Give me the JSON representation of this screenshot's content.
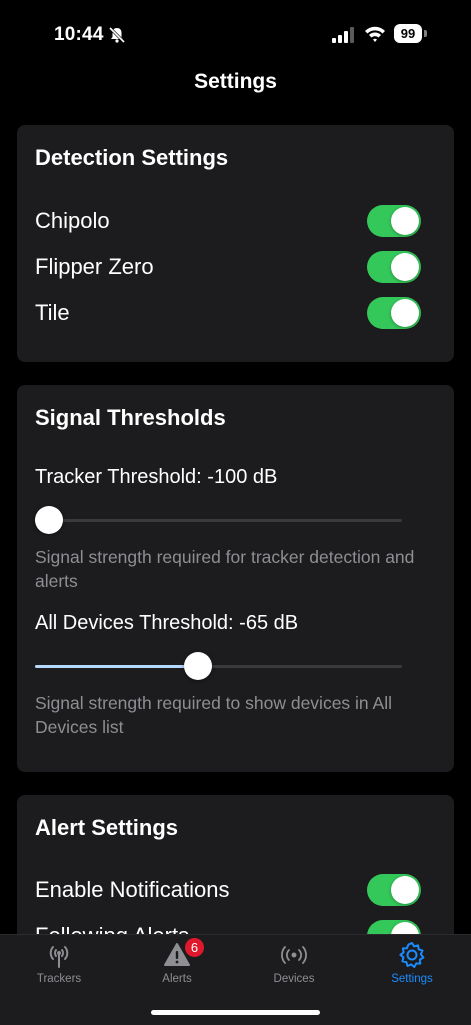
{
  "status_bar": {
    "time": "10:44",
    "battery": "99"
  },
  "nav": {
    "title": "Settings"
  },
  "detection": {
    "title": "Detection Settings",
    "items": [
      {
        "label": "Chipolo",
        "enabled": true
      },
      {
        "label": "Flipper Zero",
        "enabled": true
      },
      {
        "label": "Tile",
        "enabled": true
      }
    ]
  },
  "thresholds": {
    "title": "Signal Thresholds",
    "tracker": {
      "label": "Tracker Threshold: -100 dB",
      "value_db": -100,
      "fraction": 0.0,
      "help": "Signal strength required for tracker detection and alerts"
    },
    "all_devices": {
      "label": "All Devices Threshold: -65 dB",
      "value_db": -65,
      "fraction": 0.44,
      "help": "Signal strength required to show devices in All Devices list"
    }
  },
  "alerts": {
    "title": "Alert Settings",
    "items": [
      {
        "label": "Enable Notifications",
        "enabled": true
      },
      {
        "label": "Following Alerts",
        "enabled": true
      }
    ]
  },
  "tabs": [
    {
      "label": "Trackers",
      "icon": "antenna-icon",
      "active": false
    },
    {
      "label": "Alerts",
      "icon": "warning-icon",
      "active": false,
      "badge": "6"
    },
    {
      "label": "Devices",
      "icon": "broadcast-icon",
      "active": false
    },
    {
      "label": "Settings",
      "icon": "gear-icon",
      "active": true
    }
  ],
  "colors": {
    "toggle_on": "#34c759",
    "accent": "#1a8cff",
    "badge": "#e0182d",
    "card": "#1c1c1e"
  }
}
